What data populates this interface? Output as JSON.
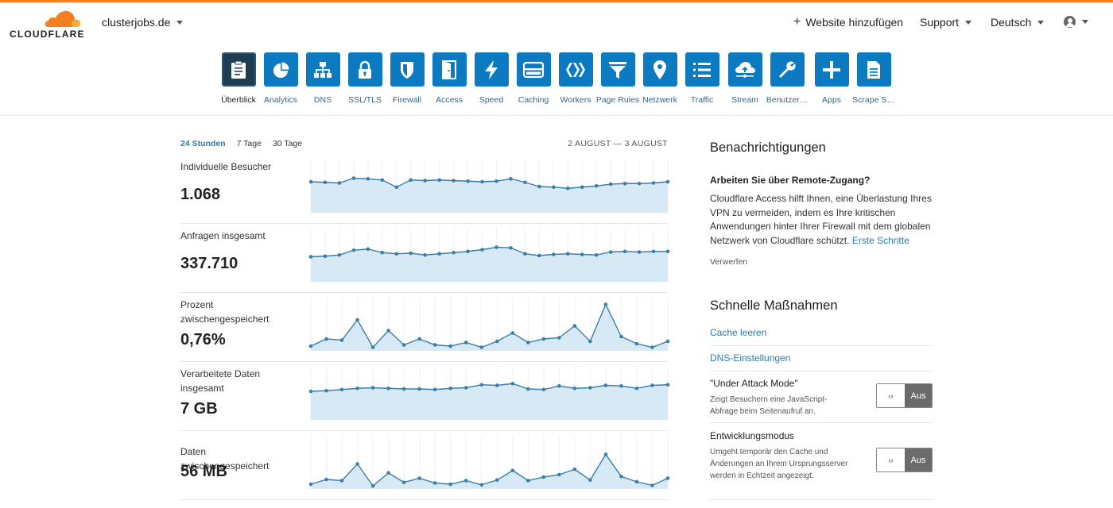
{
  "header": {
    "logo_text": "CLOUDFLARE",
    "domain": "clusterjobs.de",
    "add_site": "Website hinzufügen",
    "support": "Support",
    "language": "Deutsch"
  },
  "apps": [
    {
      "label": "Überblick",
      "icon": "clipboard-icon",
      "active": true
    },
    {
      "label": "Analytics",
      "icon": "pie-chart-icon"
    },
    {
      "label": "DNS",
      "icon": "network-icon"
    },
    {
      "label": "SSL/TLS",
      "icon": "lock-icon"
    },
    {
      "label": "Firewall",
      "icon": "shield-icon"
    },
    {
      "label": "Access",
      "icon": "door-icon"
    },
    {
      "label": "Speed",
      "icon": "lightning-icon"
    },
    {
      "label": "Caching",
      "icon": "storage-icon"
    },
    {
      "label": "Workers",
      "icon": "workers-icon"
    },
    {
      "label": "Page Rules",
      "icon": "filter-icon"
    },
    {
      "label": "Netzwerk",
      "icon": "location-pin-icon"
    },
    {
      "label": "Traffic",
      "icon": "list-icon"
    },
    {
      "label": "Stream",
      "icon": "cloud-upload-icon"
    },
    {
      "label": "Benutzer…",
      "icon": "wrench-icon"
    },
    {
      "label": "Apps",
      "icon": "plus-icon"
    },
    {
      "label": "Scrape S…",
      "icon": "document-icon"
    }
  ],
  "analytics": {
    "ranges": [
      "24 Stunden",
      "7 Tage",
      "30 Tage"
    ],
    "active_range": "24 Stunden",
    "date_range": "2 AUGUST — 3 AUGUST",
    "metrics": [
      {
        "label": "Individuelle Besucher",
        "value": "1.068",
        "series": [
          52,
          51,
          50,
          58,
          57,
          55,
          43,
          55,
          54,
          55,
          54,
          53,
          52,
          53,
          57,
          51,
          44,
          43,
          41,
          43,
          45,
          48,
          49,
          49,
          50,
          52
        ]
      },
      {
        "label": "Anfragen insgesamt",
        "value": "337.710",
        "series": [
          42,
          43,
          45,
          53,
          55,
          49,
          47,
          48,
          45,
          47,
          49,
          51,
          54,
          58,
          57,
          47,
          44,
          46,
          47,
          46,
          45,
          50,
          51,
          50,
          51,
          51
        ]
      },
      {
        "label": "Prozent zwischengespeichert",
        "value": "0,76%",
        "series": [
          8,
          20,
          18,
          52,
          6,
          34,
          10,
          20,
          10,
          8,
          14,
          6,
          16,
          30,
          14,
          20,
          22,
          42,
          16,
          78,
          24,
          12,
          6,
          16
        ]
      },
      {
        "label": "Verarbeitete Daten insgesamt",
        "value": "7 GB",
        "series": [
          48,
          49,
          51,
          53,
          54,
          53,
          52,
          52,
          51,
          53,
          54,
          59,
          58,
          61,
          52,
          51,
          57,
          53,
          54,
          58,
          57,
          53,
          58,
          59
        ]
      },
      {
        "label": "Daten zwischengespeichert",
        "value": "56 MB",
        "series": [
          8,
          16,
          14,
          42,
          5,
          27,
          11,
          18,
          10,
          8,
          14,
          7,
          15,
          31,
          14,
          20,
          24,
          33,
          15,
          58,
          21,
          12,
          6,
          18
        ]
      }
    ]
  },
  "notifications": {
    "heading": "Benachrichtigungen",
    "title": "Arbeiten Sie über Remote-Zugang?",
    "body": "Cloudflare Access hilft Ihnen, eine Überlastung Ihres VPN zu vermeiden, indem es Ihre kritischen Anwendungen hinter Ihrer Firewall mit dem globalen Netzwerk von Cloudflare schützt.",
    "link": "Erste Schritte",
    "dismiss": "Verwerfen"
  },
  "quick_actions": {
    "heading": "Schnelle Maßnahmen",
    "clear_cache": "Cache leeren",
    "dns_settings": "DNS-Einstellungen",
    "under_attack": {
      "title": "\"Under Attack Mode\"",
      "desc": "Zeigt Besuchern eine JavaScript-Abfrage beim Seitenaufruf an.",
      "state": "Aus",
      "knob": "‹›"
    },
    "dev_mode": {
      "title": "Entwicklungsmodus",
      "desc": "Umgeht temporär den Cache und Änderungen an Ihrem Ursprungsserver werden in Echtzeit angezeigt.",
      "state": "Aus",
      "knob": "‹›"
    }
  },
  "colors": {
    "brand_orange": "#f38020",
    "tile_blue": "#0c7ac1",
    "tile_active": "#1f3d52",
    "chart_line": "#3b7ea8",
    "chart_fill": "#d6e9f5",
    "link": "#2c7cb0"
  }
}
